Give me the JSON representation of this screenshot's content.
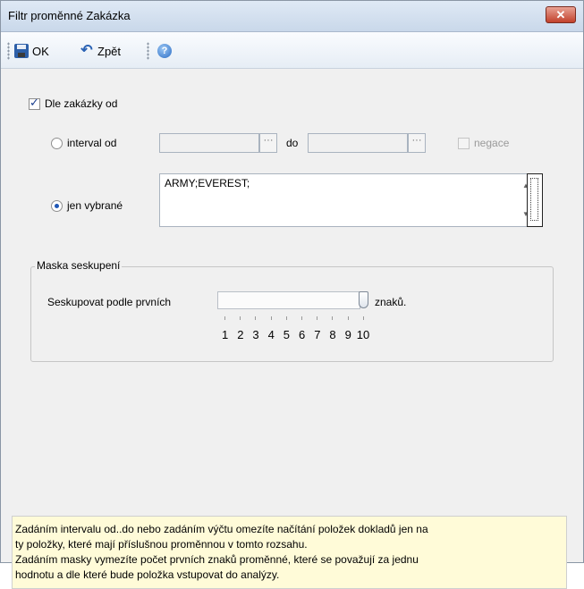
{
  "window": {
    "title": "Filtr proměnné Zakázka",
    "close_glyph": "✕"
  },
  "toolbar": {
    "ok_label": "OK",
    "back_label": "Zpět",
    "help_glyph": "?"
  },
  "filter": {
    "main_checkbox_label": "Dle zakázky od",
    "main_checked": true,
    "interval_label": "interval od",
    "interval_selected": false,
    "interval_from_value": "",
    "interval_to_value": "",
    "browse_glyph": "···",
    "to_label": "do",
    "negation_label": "negace",
    "selected_label": "jen vybrané",
    "selected_selected": true,
    "selected_values": "ARMY;EVEREST;"
  },
  "grouping": {
    "group_title": "Maska seskupení",
    "prefix_label": "Seskupovat podle prvních",
    "suffix_label": "znaků.",
    "slider_value": 10,
    "slider_min": 1,
    "slider_max": 10,
    "tick_labels": [
      "1",
      "2",
      "3",
      "4",
      "5",
      "6",
      "7",
      "8",
      "9",
      "10"
    ]
  },
  "info": {
    "line1": "Zadáním intervalu od..do nebo zadáním výčtu omezíte načítání položek dokladů jen na",
    "line2": "ty položky, které mají příslušnou proměnnou v tomto rozsahu.",
    "line3": "Zadáním masky vymezíte počet prvních znaků proměnné, které se považují za jednu",
    "line4": "hodnotu a dle které bude položka vstupovat do analýzy."
  },
  "icons": {
    "save": "floppy-icon",
    "undo": "undo-arrow-icon",
    "help": "help-icon",
    "close": "close-icon"
  },
  "colors": {
    "close_button": "#c2412b",
    "info_background": "#fffbd8",
    "radio_dot": "#1f57b6"
  }
}
